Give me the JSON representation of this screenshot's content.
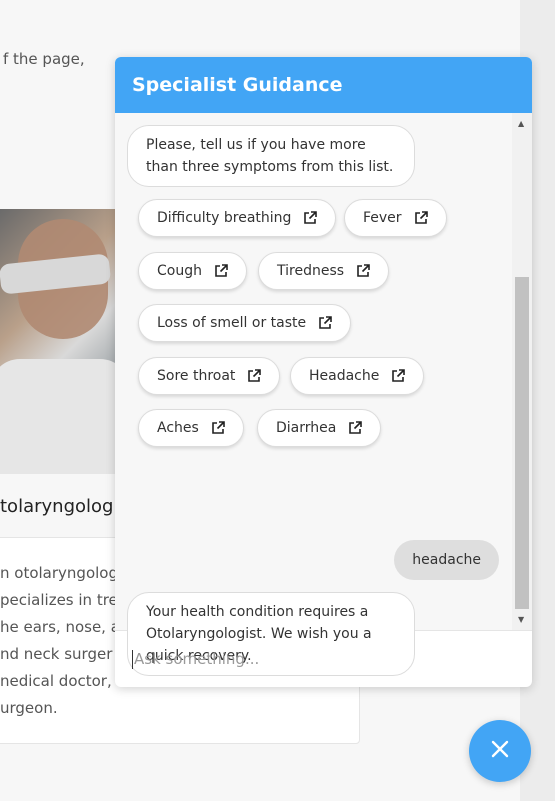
{
  "background": {
    "top_text": "f the page,",
    "card_title": "tolaryngolog",
    "card_lines": [
      "n otolaryngolog",
      "pecializes in tre",
      "he ears, nose, ar",
      "nd neck surger",
      "nedical doctor,",
      "urgeon."
    ]
  },
  "chat": {
    "title": "Specialist Guidance",
    "bot_prompt": "Please, tell us if you have more than three symptoms from this list.",
    "symptoms": [
      "Difficulty breathing",
      "Fever",
      "Cough",
      "Tiredness",
      "Loss of smell or taste",
      "Sore throat",
      "Headache",
      "Aches",
      "Diarrhea"
    ],
    "user_reply": "headache",
    "bot_response": "Your health condition requires a Otolaryngologist. We wish you a quick recovery.",
    "input_placeholder": "Ask something..."
  },
  "icons": {
    "chip": "external-link-icon",
    "fab": "close-icon"
  },
  "colors": {
    "accent": "#42a5f5"
  }
}
